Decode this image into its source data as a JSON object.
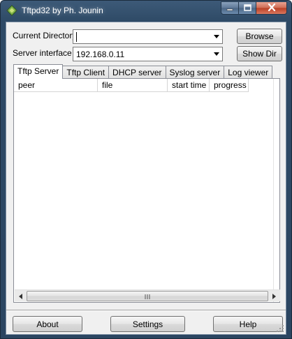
{
  "window": {
    "title": "Tftpd32 by Ph. Jounin",
    "app_icon": "tftpd32-chip-icon"
  },
  "caption_buttons": {
    "minimize": "minimize-icon",
    "maximize": "maximize-icon",
    "close": "close-icon"
  },
  "form": {
    "current_directory_label": "Current Directory",
    "current_directory_value": "",
    "server_interface_label": "Server interface",
    "server_interface_value": "192.168.0.11",
    "browse_label": "Browse",
    "show_dir_label": "Show Dir"
  },
  "tabs": [
    {
      "label": "Tftp Server",
      "active": true
    },
    {
      "label": "Tftp Client",
      "active": false
    },
    {
      "label": "DHCP server",
      "active": false
    },
    {
      "label": "Syslog server",
      "active": false
    },
    {
      "label": "Log viewer",
      "active": false
    }
  ],
  "table": {
    "columns": [
      "peer",
      "file",
      "start time",
      "progress"
    ],
    "rows": []
  },
  "scrollbar": {
    "left_arrow": "arrow-left-icon",
    "right_arrow": "arrow-right-icon",
    "thumb_grip": "grip-icon"
  },
  "bottom_buttons": {
    "about_label": "About",
    "settings_label": "Settings",
    "help_label": "Help"
  },
  "colors": {
    "titlebar": "#2e4a66",
    "client_bg": "#f0f0f0",
    "close_button": "#c4472d"
  }
}
